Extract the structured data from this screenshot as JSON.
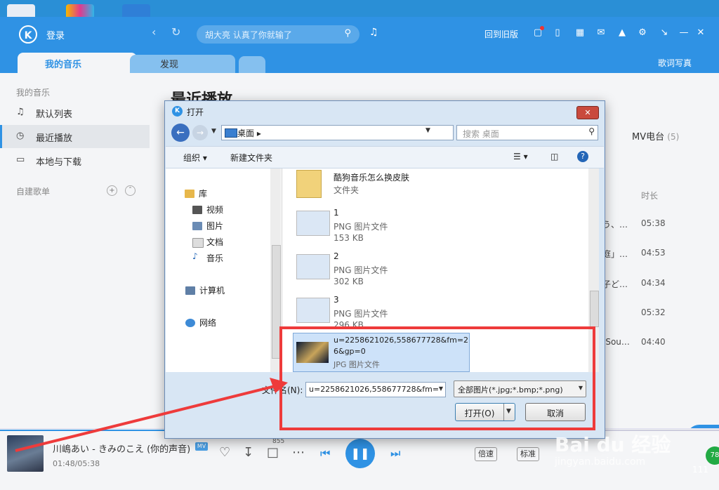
{
  "app": {
    "login": "登录",
    "search_placeholder": "胡大亮 认真了你就输了",
    "old_version": "回到旧版",
    "tab_mine": "我的音乐",
    "tab_find": "发现",
    "lyric_tab": "歌词写真",
    "sidebar": {
      "heading": "我的音乐",
      "items": [
        {
          "label": "默认列表",
          "icon": "playlist-icon"
        },
        {
          "label": "最近播放",
          "icon": "clock-icon"
        },
        {
          "label": "本地与下载",
          "icon": "monitor-icon"
        }
      ],
      "own_playlists": "自建歌单"
    },
    "main_title": "最近播放",
    "mv_tab": "MV电台",
    "mv_count": "(5)",
    "duration_header": "时长",
    "rows": [
      {
        "frag": "う、…",
        "dur": "05:38"
      },
      {
        "frag": "庭」…",
        "dur": "04:53"
      },
      {
        "frag": "子ど…",
        "dur": "04:34"
      },
      {
        "frag": "",
        "dur": "05:32"
      },
      {
        "frag": "-Sou…",
        "dur": "04:40"
      }
    ]
  },
  "player": {
    "song": "川嶋あい - きみのこえ (你的声音)",
    "mv_badge": "MV",
    "time": "01:48/05:38",
    "download_count": "855",
    "speed": "倍速",
    "quality": "标准",
    "count": "111",
    "progress": 0.32
  },
  "dialog": {
    "title": "打开",
    "close": "✕",
    "address": "桌面",
    "search_placeholder": "搜索 桌面",
    "organize": "组织 ▾",
    "new_folder": "新建文件夹",
    "nav": [
      {
        "label": "库"
      },
      {
        "label": "视频"
      },
      {
        "label": "图片"
      },
      {
        "label": "文档"
      },
      {
        "label": "音乐"
      },
      {
        "label": "计算机"
      },
      {
        "label": "网络"
      }
    ],
    "files": [
      {
        "name": "酷狗音乐怎么换皮肤",
        "type": "文件夹",
        "size": ""
      },
      {
        "name": "1",
        "type": "PNG 图片文件",
        "size": "153 KB"
      },
      {
        "name": "2",
        "type": "PNG 图片文件",
        "size": "302 KB"
      },
      {
        "name": "3",
        "type": "PNG 图片文件",
        "size": "296 KB"
      },
      {
        "name_line1": "u=2258621026,558677728&fm=2",
        "name_line2": "6&gp=0",
        "type": "JPG 图片文件"
      }
    ],
    "filename_label": "文件名(N):",
    "filename_value": "u=2258621026,558677728&fm=",
    "filetype_value": "全部图片(*.jpg;*.bmp;*.png)",
    "open_button": "打开(O)",
    "cancel_button": "取消"
  },
  "watermark": {
    "brand": "Bai du 经验",
    "url": "jingyan.baidu.com"
  },
  "green_badge": "78",
  "colors": {
    "accent": "#2f92e4",
    "highlight": "#ee3b3b"
  }
}
